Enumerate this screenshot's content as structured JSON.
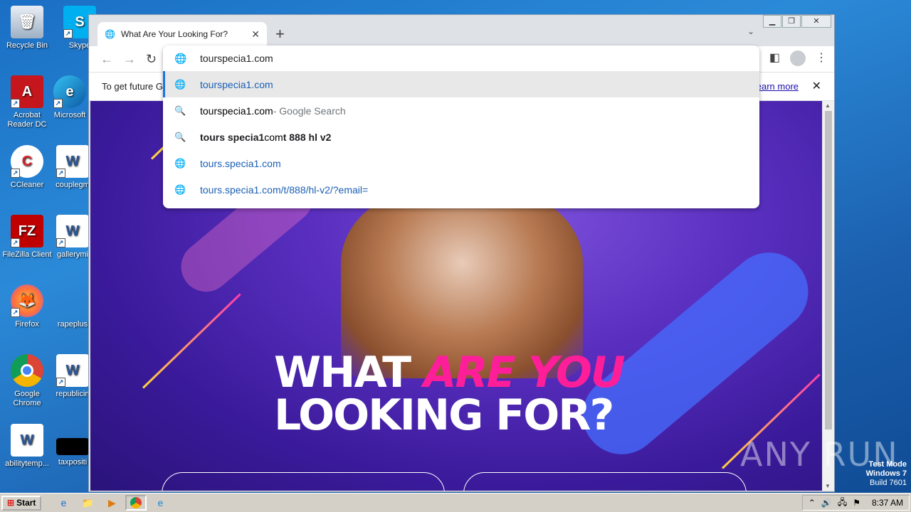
{
  "desktop": {
    "icons": [
      {
        "label": "Recycle Bin"
      },
      {
        "label": "Skype"
      },
      {
        "label": "Acrobat Reader DC"
      },
      {
        "label": "Microsoft"
      },
      {
        "label": "CCleaner"
      },
      {
        "label": "couplegm"
      },
      {
        "label": "FileZilla Client"
      },
      {
        "label": "gallerymi"
      },
      {
        "label": "Firefox"
      },
      {
        "label": "rapeplus"
      },
      {
        "label": "Google Chrome"
      },
      {
        "label": "republicin"
      },
      {
        "label": "abilitytemp..."
      },
      {
        "label": "taxpositi"
      }
    ]
  },
  "browser": {
    "tab_title": "What Are Your Looking For?",
    "omnibox_value": "tourspecia1.com",
    "suggestions": [
      {
        "icon": "globe-icon",
        "text": "tourspecia1.com",
        "suffix": ""
      },
      {
        "icon": "search-icon",
        "text": "tourspecia1.com",
        "suffix": " - Google Search"
      },
      {
        "icon": "search-icon",
        "text": "tours specia1",
        "suffix": " com",
        "tail": " t 888 hl v2"
      },
      {
        "icon": "globe-icon",
        "text": "tours.specia1.com",
        "suffix": ""
      },
      {
        "icon": "globe-icon",
        "text": "tours.specia1.com/t/888/hl-v2/?email=",
        "suffix": ""
      }
    ],
    "infobar_text": "To get future G",
    "infobar_link": "earn more"
  },
  "page": {
    "headline_line1_white": "WHAT ",
    "headline_line1_pink": "ARE YOU",
    "headline_line2": "LOOKING FOR?"
  },
  "overlay": {
    "watermark": "ANY RUN",
    "test_mode": "Test Mode",
    "os": "Windows 7",
    "build": "Build 7601"
  },
  "taskbar": {
    "start_label": "Start",
    "clock": "8:37 AM"
  },
  "colors": {
    "accent": "#1a73e8",
    "headline_pink": "#ff1e9a",
    "page_bg": "#5a2fc0"
  }
}
